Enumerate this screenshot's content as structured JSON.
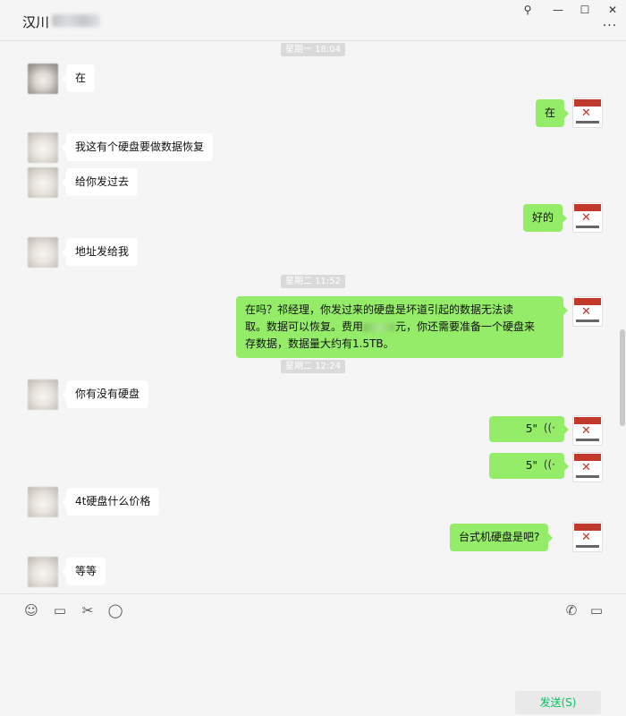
{
  "window": {
    "title": "汉川",
    "controls": {
      "pin": "⚲",
      "minimize": "—",
      "maximize": "☐",
      "close": "✕"
    },
    "more": "···"
  },
  "timestamps": [
    "星期一 18:04",
    "星期二 11:52",
    "星期二 12:24"
  ],
  "messages": [
    {
      "side": "in",
      "text": "在"
    },
    {
      "side": "out",
      "text": "在"
    },
    {
      "side": "in",
      "text": "我这有个硬盘要做数据恢复"
    },
    {
      "side": "in",
      "text": "给你发过去"
    },
    {
      "side": "out",
      "text": "好的"
    },
    {
      "side": "in",
      "text": "地址发给我"
    },
    {
      "side": "out",
      "line1": "在吗？祁经理，你发过来的硬盘是坏道引起的数据无法读",
      "line2a": "取。数据可以恢复。费用",
      "line2b": "元，你还需要准备一个硬盘来",
      "line3": "存数据，数据量大约有1.5TB。"
    },
    {
      "side": "in",
      "text": "你有没有硬盘"
    },
    {
      "side": "out",
      "type": "voice",
      "duration": "5\""
    },
    {
      "side": "out",
      "type": "voice",
      "duration": "5\""
    },
    {
      "side": "in",
      "text": "4t硬盘什么价格"
    },
    {
      "side": "out",
      "text": "台式机硬盘是吧?"
    },
    {
      "side": "in",
      "text": "等等"
    }
  ],
  "voice_icon": "((·",
  "toolbar": {
    "emoji_icon": "☺",
    "folder_icon": "▭",
    "scissors_icon": "✂",
    "chat_icon": "◯",
    "phone_icon": "✆",
    "video_icon": "▭",
    "send_label": "发送(S)"
  },
  "colors": {
    "bubble_out": "#95ec69",
    "bubble_in": "#ffffff",
    "send_text": "#07c160"
  }
}
